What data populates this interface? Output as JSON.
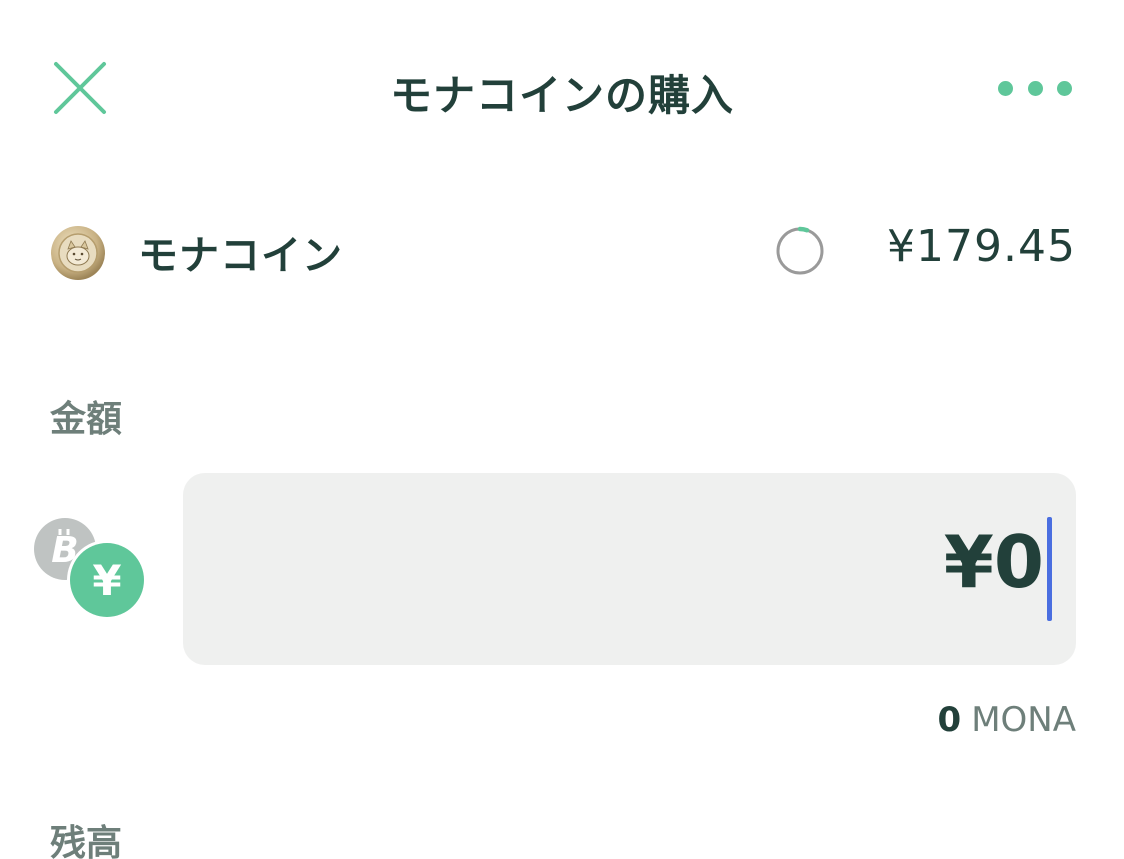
{
  "header": {
    "title": "モナコインの購入",
    "close_icon": "close-x-icon",
    "more_icon": "more-horizontal-icon"
  },
  "coin": {
    "name": "モナコイン",
    "price": "¥179.45",
    "logo_icon": "monacoin-logo-icon",
    "refresh_icon": "refresh-timer-icon"
  },
  "amount": {
    "label": "金額",
    "value": "¥0",
    "converted_value": "0",
    "converted_unit": "MONA",
    "toggle_icons": [
      "bitcoin-icon",
      "yen-icon"
    ]
  },
  "balance": {
    "label": "残高"
  },
  "colors": {
    "accent": "#5fc79a",
    "text": "#22403a",
    "muted": "#6e7f7a",
    "input_bg": "#eff0ef",
    "caret": "#4a6ee0"
  }
}
